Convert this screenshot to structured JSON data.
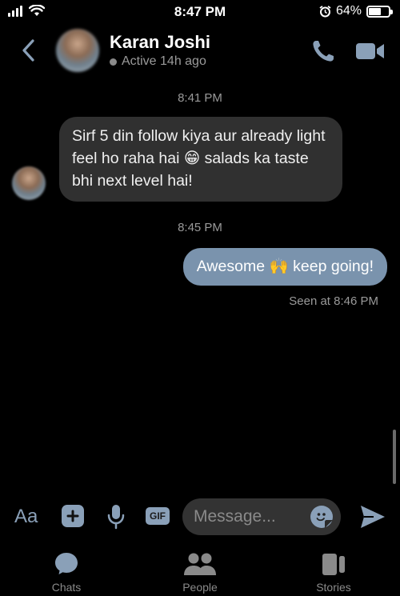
{
  "status_bar": {
    "time": "8:47 PM",
    "battery": "64%",
    "battery_level": 0.64
  },
  "header": {
    "contact_name": "Karan Joshi",
    "status": "Active 14h ago",
    "icons": [
      "back-chevron-icon",
      "phone-icon",
      "video-camera-icon"
    ]
  },
  "conversation": {
    "timestamp_1": "8:41 PM",
    "incoming_message": "Sirf 5 din follow kiya aur already light feel ho raha hai 😁 salads ka taste bhi next level hai!",
    "timestamp_2": "8:45 PM",
    "outgoing_message": "Awesome 🙌 keep going!",
    "seen_status": "Seen at 8:46 PM"
  },
  "composer": {
    "aa_label": "Aa",
    "gif_label": "GIF",
    "placeholder": "Message..."
  },
  "tabs": [
    {
      "label": "Chats",
      "icon": "chat-bubble-icon"
    },
    {
      "label": "People",
      "icon": "people-icon"
    },
    {
      "label": "Stories",
      "icon": "stories-icon"
    }
  ],
  "colors": {
    "background": "#000000",
    "accent": "#8aa0b8",
    "outgoing_bubble": "#7a93ad",
    "incoming_bubble": "#303030"
  }
}
